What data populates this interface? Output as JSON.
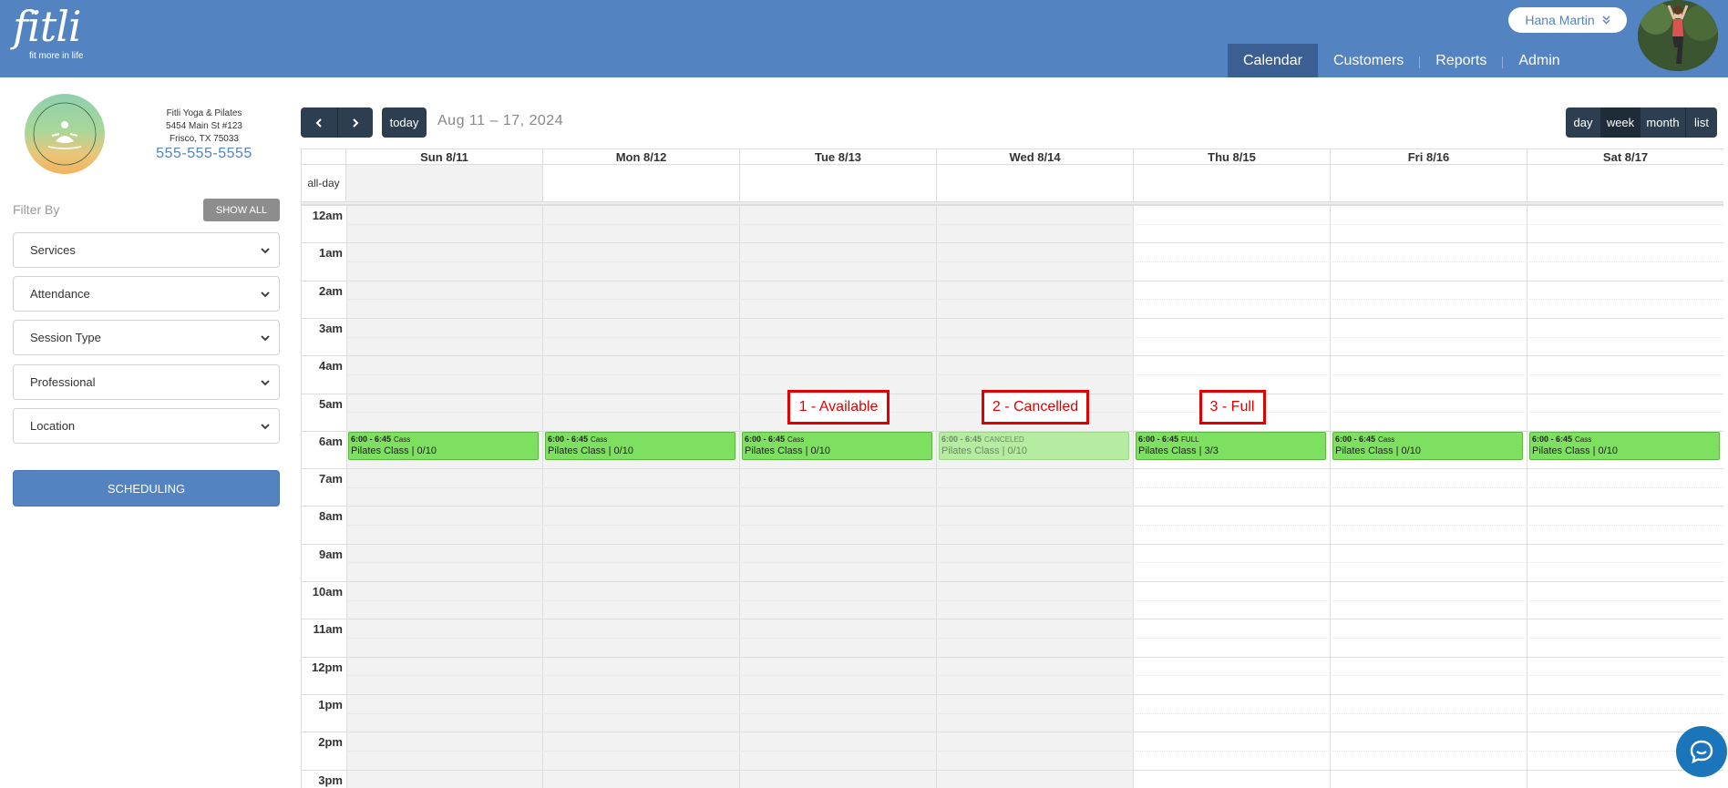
{
  "header": {
    "logo_text": "fitli",
    "logo_tagline": "fit more in life",
    "user_name": "Hana Martin",
    "nav": [
      {
        "label": "Calendar",
        "active": true
      },
      {
        "label": "Customers",
        "active": false
      },
      {
        "label": "Reports",
        "active": false
      },
      {
        "label": "Admin",
        "active": false
      }
    ],
    "brand_color": "#5483c1"
  },
  "studio": {
    "logo_text": "FITLI YOGA & PILATES",
    "name": "Fitli Yoga & Pilates",
    "address1": "5454 Main St #123",
    "address2": "Frisco, TX 75033",
    "phone": "555-555-5555"
  },
  "filters": {
    "label": "Filter By",
    "show_all": "SHOW ALL",
    "selects": [
      "Services",
      "Attendance",
      "Session Type",
      "Professional",
      "Location"
    ],
    "scheduling": "SCHEDULING"
  },
  "toolbar": {
    "today": "today",
    "range": "Aug 11 – 17, 2024",
    "views": [
      "day",
      "week",
      "month",
      "list"
    ],
    "active_view": "week"
  },
  "calendar": {
    "allday_label": "all-day",
    "days": [
      "Sun 8/11",
      "Mon 8/12",
      "Tue 8/13",
      "Wed 8/14",
      "Thu 8/15",
      "Fri 8/16",
      "Sat 8/17"
    ],
    "past_days": 4,
    "hours": [
      "12am",
      "1am",
      "2am",
      "3am",
      "4am",
      "5am",
      "6am",
      "7am",
      "8am",
      "9am",
      "10am",
      "11am",
      "12pm",
      "1pm",
      "2pm",
      "3pm"
    ],
    "events": [
      {
        "day": 0,
        "time": "6:00 - 6:45",
        "status": "Cass",
        "title": "Pilates Class | 0/10",
        "cancelled": false
      },
      {
        "day": 1,
        "time": "6:00 - 6:45",
        "status": "Cass",
        "title": "Pilates Class | 0/10",
        "cancelled": false
      },
      {
        "day": 2,
        "time": "6:00 - 6:45",
        "status": "Cass",
        "title": "Pilates Class | 0/10",
        "cancelled": false
      },
      {
        "day": 3,
        "time": "6:00 - 6:45",
        "status": "CANCELED",
        "title": "Pilates Class | 0/10",
        "cancelled": true
      },
      {
        "day": 4,
        "time": "6:00 - 6:45",
        "status": "FULL",
        "title": "Pilates Class | 3/3",
        "cancelled": false
      },
      {
        "day": 5,
        "time": "6:00 - 6:45",
        "status": "Cass",
        "title": "Pilates Class | 0/10",
        "cancelled": false
      },
      {
        "day": 6,
        "time": "6:00 - 6:45",
        "status": "Cass",
        "title": "Pilates Class | 0/10",
        "cancelled": false
      }
    ],
    "event_color": "#7ee060"
  },
  "annotations": [
    {
      "day": 2,
      "text": "1 - Available"
    },
    {
      "day": 3,
      "text": "2 - Cancelled"
    },
    {
      "day": 4,
      "text": "3 - Full"
    }
  ]
}
